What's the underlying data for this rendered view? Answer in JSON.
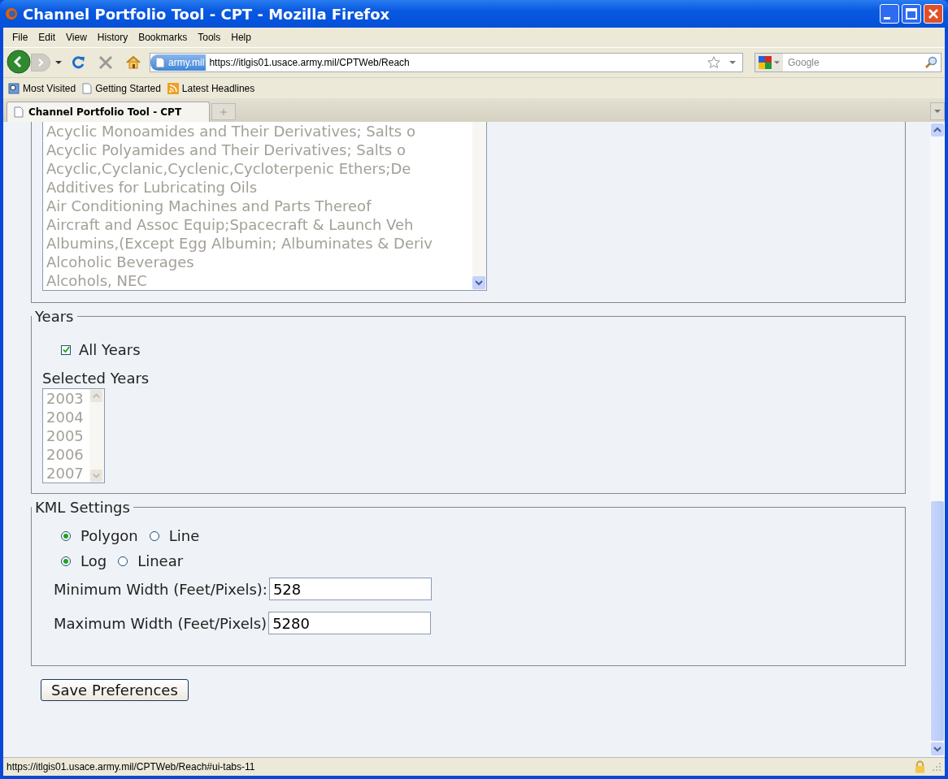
{
  "window": {
    "title": "Channel Portfolio Tool - CPT - Mozilla Firefox"
  },
  "menu": [
    "File",
    "Edit",
    "View",
    "History",
    "Bookmarks",
    "Tools",
    "Help"
  ],
  "address_bar": {
    "site_badge": "army.mil",
    "url": "https://itlgis01.usace.army.mil/CPTWeb/Reach"
  },
  "search": {
    "placeholder": "Google"
  },
  "bookmarks": [
    "Most Visited",
    "Getting Started",
    "Latest Headlines"
  ],
  "tabs": [
    {
      "label": "Channel Portfolio Tool - CPT",
      "selected": true
    }
  ],
  "commodities": {
    "disabled": true,
    "items": [
      "Acyclic Monoamides and Their Derivatives; Salts o",
      "Acyclic Polyamides and Their Derivatives; Salts o",
      "Acyclic,Cyclanic,Cyclenic,Cycloterpenic Ethers;De",
      "Additives for Lubricating Oils",
      "Air Conditioning Machines and Parts Thereof",
      "Aircraft and Assoc Equip;Spacecraft & Launch Veh",
      "Albumins,(Except Egg Albumin; Albuminates & Deriv",
      "Alcoholic Beverages",
      "Alcohols, NEC"
    ]
  },
  "years": {
    "legend": "Years",
    "all_years": {
      "label": "All Years",
      "checked": true
    },
    "list_label": "Selected Years",
    "disabled": true,
    "items": [
      "2003",
      "2004",
      "2005",
      "2006",
      "2007"
    ]
  },
  "kml": {
    "legend": "KML Settings",
    "radio_groups": [
      [
        {
          "label": "Polygon",
          "selected": true
        },
        {
          "label": "Line",
          "selected": false
        }
      ],
      [
        {
          "label": "Log",
          "selected": true
        },
        {
          "label": "Linear",
          "selected": false
        }
      ]
    ],
    "fields": [
      {
        "label": "Minimum Width (Feet/Pixels):",
        "value": "528"
      },
      {
        "label": "Maximum Width (Feet/Pixels)",
        "value": "5280"
      }
    ]
  },
  "save_button": "Save Preferences",
  "status_bar": "https://itlgis01.usace.army.mil/CPTWeb/Reach#ui-tabs-11"
}
